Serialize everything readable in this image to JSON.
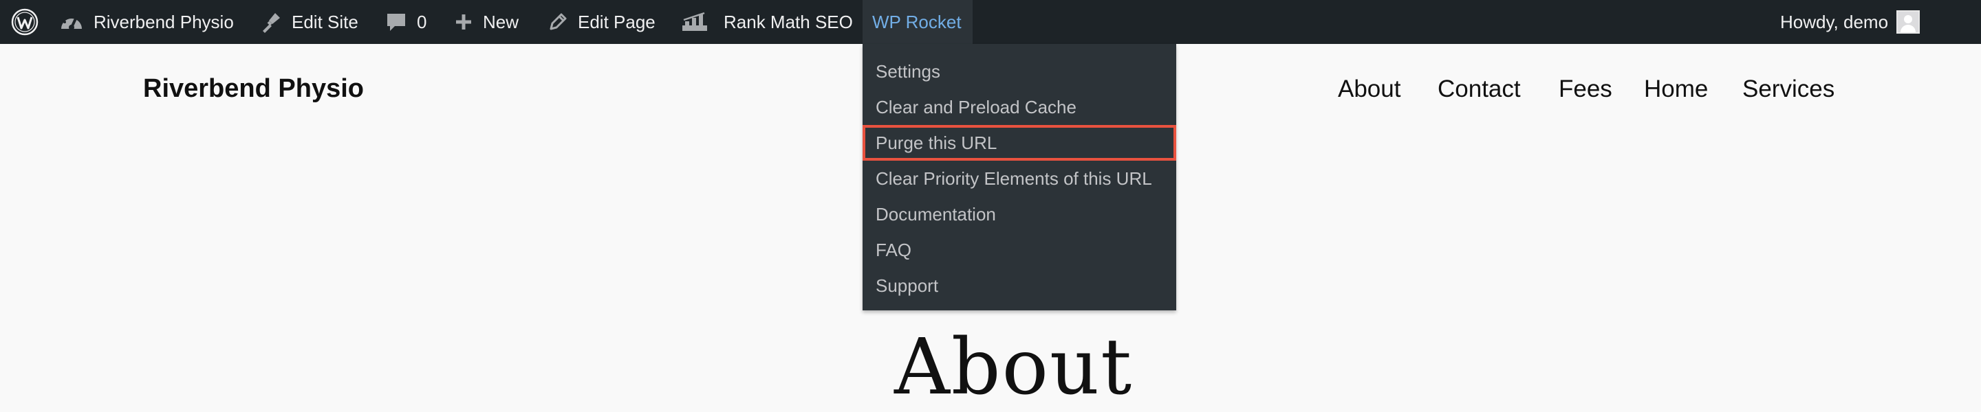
{
  "admin_bar": {
    "site_name": "Riverbend Physio",
    "edit_site": "Edit Site",
    "comments_count": "0",
    "new_label": "New",
    "edit_page": "Edit Page",
    "rank_math": "Rank Math SEO",
    "wp_rocket": "WP Rocket",
    "howdy": "Howdy, demo",
    "icons": {
      "wp": "wordpress-logo-icon",
      "site": "dashboard-gauge-icon",
      "edit_site": "brush-icon",
      "comments": "comment-bubble-icon",
      "new": "plus-icon",
      "edit_page": "pencil-icon",
      "rank_math": "rank-math-icon",
      "avatar": "user-avatar-icon"
    },
    "colors": {
      "background": "#1d2327",
      "text": "#f0f0f1",
      "active_text": "#72aee6"
    }
  },
  "rocket_menu": {
    "items": [
      "Settings",
      "Clear and Preload Cache",
      "Purge this URL",
      "Clear Priority Elements of this URL",
      "Documentation",
      "FAQ",
      "Support"
    ],
    "highlighted_item": "Purge this URL",
    "colors": {
      "background": "#2c3338",
      "text": "#c3c4c7",
      "highlight_border": "#e8523f"
    }
  },
  "site": {
    "title": "Riverbend Physio",
    "nav": [
      "About",
      "Contact",
      "Fees",
      "Home",
      "Services"
    ],
    "page_heading": "About"
  }
}
